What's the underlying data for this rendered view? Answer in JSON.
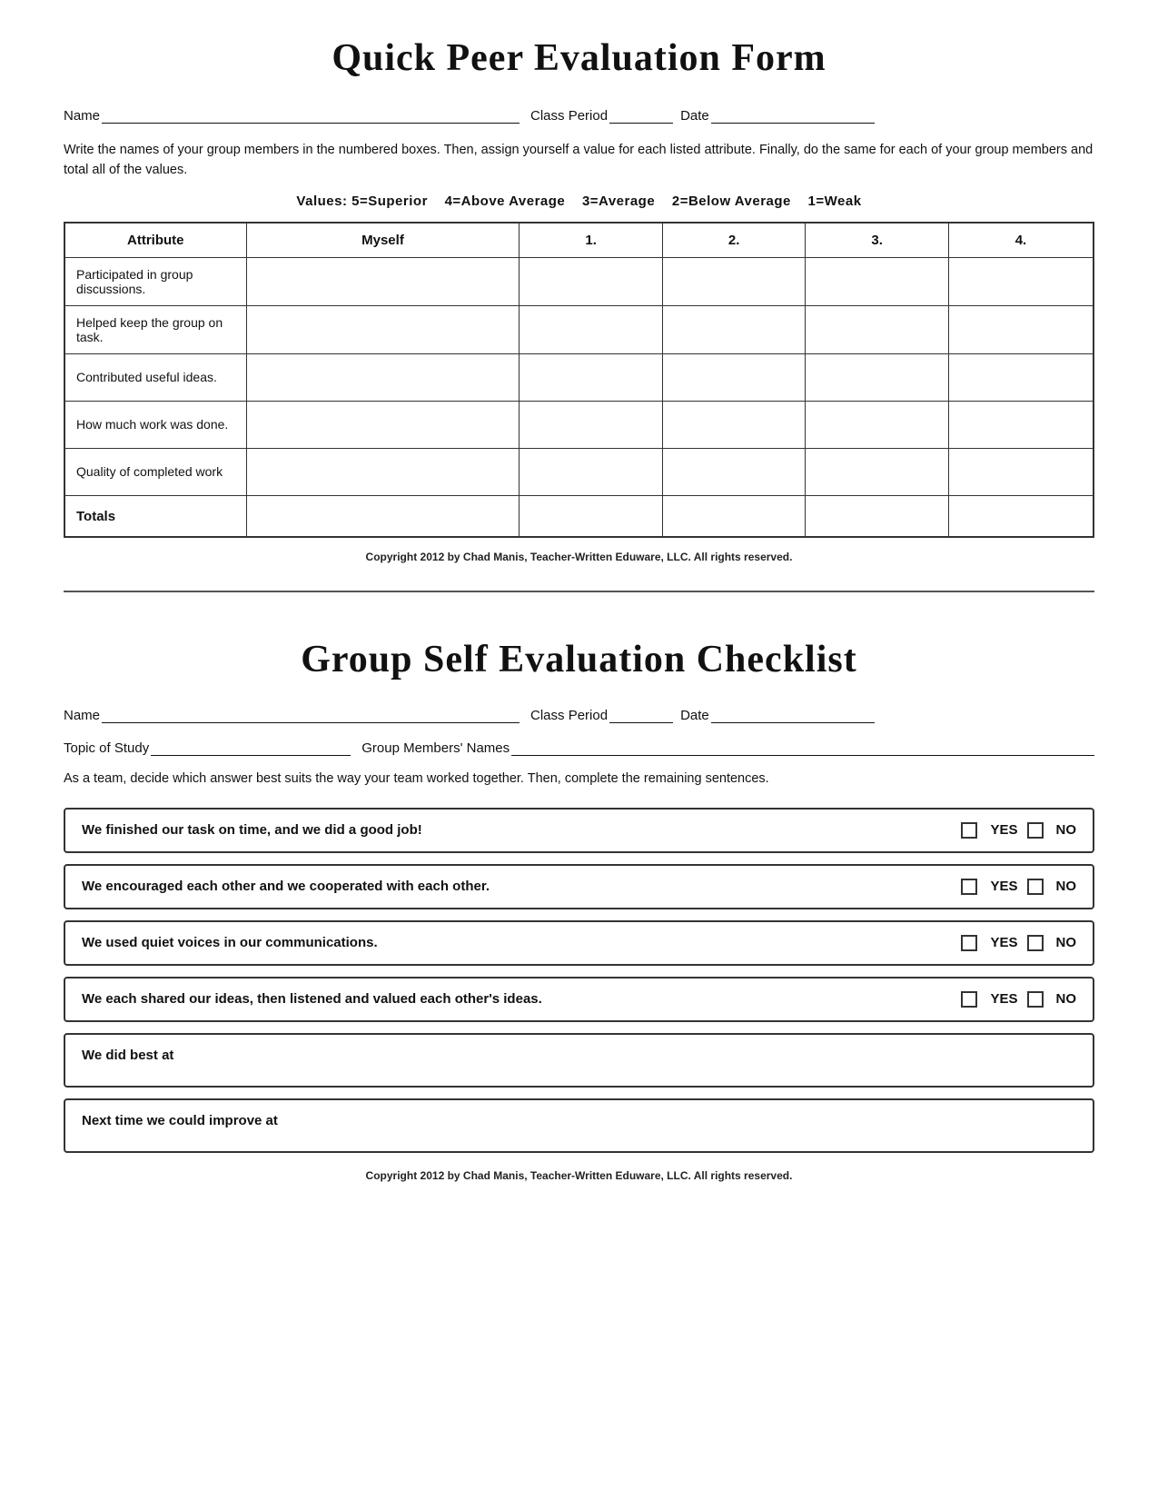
{
  "section1": {
    "title": "Quick Peer Evaluation Form",
    "name_label": "Name",
    "class_label": "Class Period",
    "date_label": "Date",
    "instructions": "Write the names of your group members in the numbered boxes.  Then,  assign yourself a value for each listed attribute.  Finally, do the same for each of your group members and total all of the values.",
    "values_label": "Values:",
    "values": "5=Superior    4=Above Average    3=Average    2=Below Average    1=Weak",
    "table": {
      "headers": [
        "Attribute",
        "Myself",
        "1.",
        "2.",
        "3.",
        "4."
      ],
      "rows": [
        [
          "Participated in group discussions.",
          "",
          "",
          "",
          "",
          ""
        ],
        [
          "Helped keep the group on task.",
          "",
          "",
          "",
          "",
          ""
        ],
        [
          "Contributed useful ideas.",
          "",
          "",
          "",
          "",
          ""
        ],
        [
          "How much work was done.",
          "",
          "",
          "",
          "",
          ""
        ],
        [
          "Quality of completed work",
          "",
          "",
          "",
          "",
          ""
        ],
        [
          "Totals",
          "",
          "",
          "",
          "",
          ""
        ]
      ]
    },
    "copyright": "Copyright 2012 by Chad Manis, Teacher-Written Eduware, LLC.  All rights reserved."
  },
  "section2": {
    "title": "Group Self Evaluation Checklist",
    "name_label": "Name",
    "class_label": "Class Period",
    "date_label": "Date",
    "topic_label": "Topic of Study",
    "group_label": "Group Members' Names",
    "instructions": "As a team, decide which answer best suits the way your team worked together.  Then, complete the remaining sentences.",
    "checklist": [
      {
        "text": "We finished our task on time, and we did a good job!",
        "yes": "YES",
        "no": "NO"
      },
      {
        "text": "We encouraged each other and we cooperated with each other.",
        "yes": "YES",
        "no": "NO"
      },
      {
        "text": "We used quiet voices in our communications.",
        "yes": "YES",
        "no": "NO"
      },
      {
        "text": "We each shared our ideas, then listened and valued each other's ideas.",
        "yes": "YES",
        "no": "NO"
      }
    ],
    "open_items": [
      "We did best at",
      "Next time we could improve at"
    ],
    "copyright": "Copyright 2012 by Chad Manis, Teacher-Written Eduware, LLC.  All rights reserved."
  }
}
